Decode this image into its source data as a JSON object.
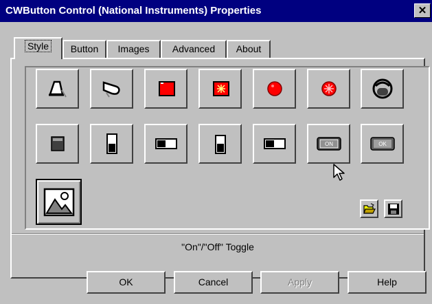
{
  "window": {
    "title": "CWButton Control  (National Instruments) Properties",
    "close_symbol": "✕"
  },
  "tabs": [
    {
      "label": "Style",
      "active": true
    },
    {
      "label": "Button",
      "active": false
    },
    {
      "label": "Images",
      "active": false
    },
    {
      "label": "Advanced",
      "active": false
    },
    {
      "label": "About",
      "active": false
    }
  ],
  "styles": [
    {
      "name": "bell-style-icon",
      "selected": false
    },
    {
      "name": "horn-style-icon",
      "selected": false
    },
    {
      "name": "red-square-led-icon",
      "selected": false
    },
    {
      "name": "red-flash-square-led-icon",
      "selected": false
    },
    {
      "name": "red-round-led-icon",
      "selected": false
    },
    {
      "name": "red-flash-round-led-icon",
      "selected": false
    },
    {
      "name": "round-push-button-icon",
      "selected": false
    },
    {
      "name": "square-push-button-icon",
      "selected": false
    },
    {
      "name": "vertical-toggle-icon",
      "selected": false
    },
    {
      "name": "horizontal-toggle-icon",
      "selected": false
    },
    {
      "name": "vertical-slide-icon",
      "selected": false
    },
    {
      "name": "horizontal-slide-icon",
      "selected": false
    },
    {
      "name": "on-off-toggle-icon",
      "selected": false,
      "text": "ON"
    },
    {
      "name": "ok-button-icon",
      "selected": false,
      "text": "OK"
    },
    {
      "name": "custom-image-icon",
      "selected": true
    }
  ],
  "colors": {
    "led_red": "#ff0000",
    "title_bg": "#000080",
    "face": "#c0c0c0"
  },
  "toolbar": {
    "open_icon": "folder-open-icon",
    "save_icon": "floppy-disk-icon"
  },
  "description": "\"On\"/\"Off\" Toggle",
  "buttons": [
    {
      "label": "OK",
      "enabled": true
    },
    {
      "label": "Cancel",
      "enabled": true
    },
    {
      "label": "Apply",
      "enabled": false
    },
    {
      "label": "Help",
      "enabled": true
    }
  ]
}
